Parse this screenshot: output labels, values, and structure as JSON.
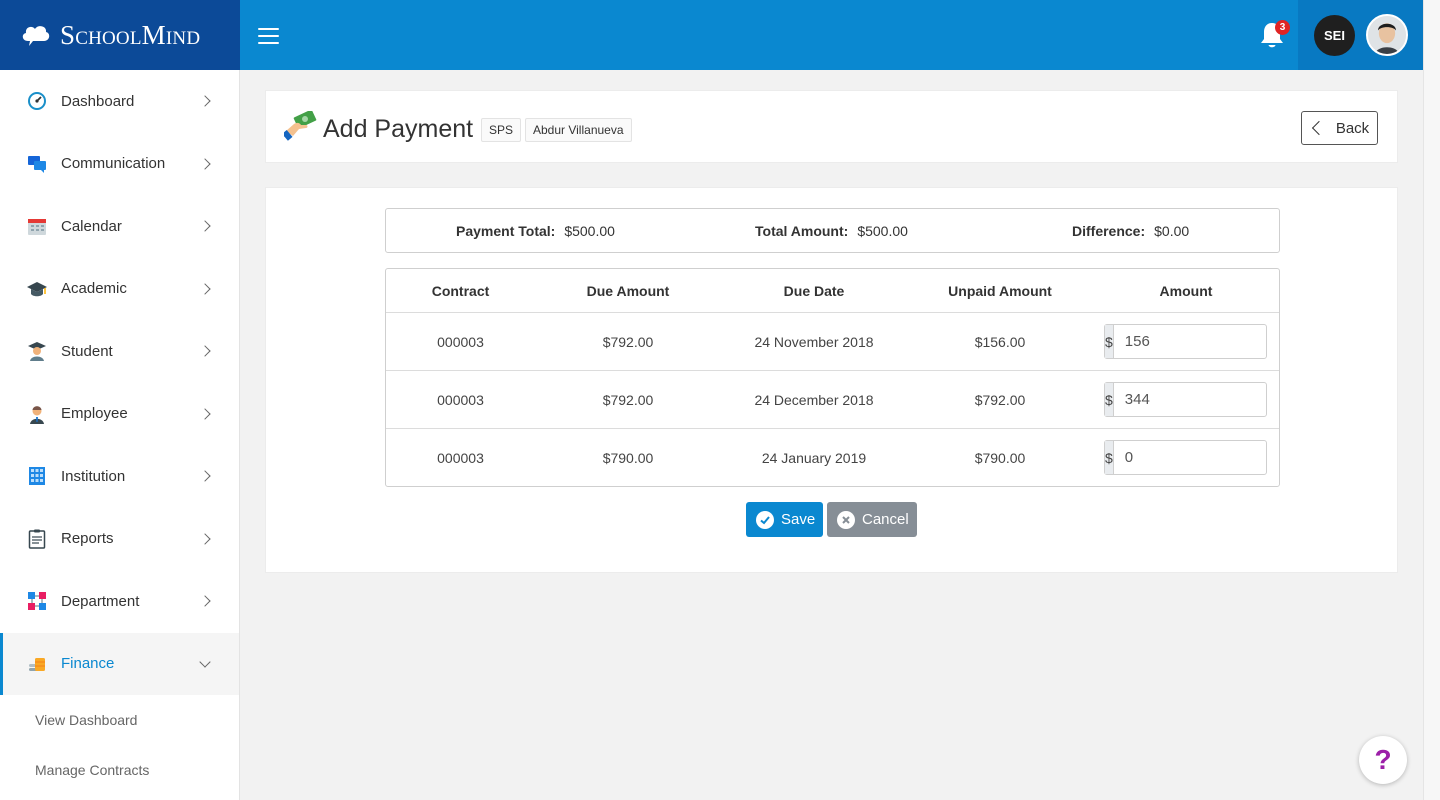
{
  "brand": {
    "name": "SchoolMind"
  },
  "topbar": {
    "notification_count": "3",
    "user_initials": "SEI"
  },
  "sidebar": {
    "items": [
      {
        "label": "Dashboard",
        "icon": "speedometer-icon"
      },
      {
        "label": "Communication",
        "icon": "chat-bubbles-icon"
      },
      {
        "label": "Calendar",
        "icon": "calendar-icon"
      },
      {
        "label": "Academic",
        "icon": "graduation-cap-icon"
      },
      {
        "label": "Student",
        "icon": "student-icon"
      },
      {
        "label": "Employee",
        "icon": "employee-icon"
      },
      {
        "label": "Institution",
        "icon": "building-icon"
      },
      {
        "label": "Reports",
        "icon": "clipboard-icon"
      },
      {
        "label": "Department",
        "icon": "org-chart-icon"
      },
      {
        "label": "Finance",
        "icon": "coins-icon",
        "active": true
      }
    ],
    "finance_sub": [
      "View Dashboard",
      "Manage Contracts"
    ]
  },
  "header": {
    "title": "Add Payment",
    "tags": [
      "SPS",
      "Abdur Villanueva"
    ],
    "back_label": "Back"
  },
  "summary": {
    "payment_total_label": "Payment Total",
    "payment_total_value": "$500.00",
    "total_amount_label": "Total Amount",
    "total_amount_value": "$500.00",
    "difference_label": "Difference",
    "difference_value": "$0.00"
  },
  "table": {
    "columns": [
      "Contract",
      "Due Amount",
      "Due Date",
      "Unpaid Amount",
      "Amount"
    ],
    "currency_prefix": "$",
    "rows": [
      {
        "contract": "000003",
        "due_amount": "$792.00",
        "due_date": "24 November 2018",
        "unpaid": "$156.00",
        "amount": "156"
      },
      {
        "contract": "000003",
        "due_amount": "$792.00",
        "due_date": "24 December 2018",
        "unpaid": "$792.00",
        "amount": "344"
      },
      {
        "contract": "000003",
        "due_amount": "$790.00",
        "due_date": "24 January 2019",
        "unpaid": "$790.00",
        "amount": "0"
      }
    ]
  },
  "actions": {
    "save_label": "Save",
    "cancel_label": "Cancel"
  },
  "help": {
    "label": "?"
  },
  "colors": {
    "primary": "#0a88d0",
    "brand_dark": "#0c4a98",
    "cancel": "#868e96",
    "badge": "#e02424",
    "help": "#9c1fa8"
  }
}
